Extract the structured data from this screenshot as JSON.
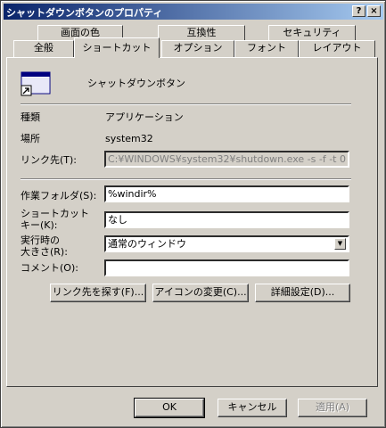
{
  "window": {
    "title": "シャットダウンボタンのプロパティ",
    "help": "?",
    "close": "×"
  },
  "tabs_back": [
    "画面の色",
    "互換性",
    "セキュリティ"
  ],
  "tabs_front": [
    "全般",
    "ショートカット",
    "オプション",
    "フォント",
    "レイアウト"
  ],
  "header": {
    "name": "シャットダウンボタン"
  },
  "info": {
    "type_label": "種類",
    "type_value": "アプリケーション",
    "location_label": "場所",
    "location_value": "system32",
    "target_label": "リンク先(T):",
    "target_value": "C:¥WINDOWS¥system32¥shutdown.exe -s -f -t 0"
  },
  "fields": {
    "workdir_label": "作業フォルダ(S):",
    "workdir_value": "%windir%",
    "shortcut_label_1": "ショートカット",
    "shortcut_label_2": "キー(K):",
    "shortcut_value": "なし",
    "run_label_1": "実行時の",
    "run_label_2": "大きさ(R):",
    "run_value": "通常のウィンドウ",
    "comment_label": "コメント(O):",
    "comment_value": ""
  },
  "buttons": {
    "find_target": "リンク先を探す(F)...",
    "change_icon": "アイコンの変更(C)...",
    "advanced": "詳細設定(D)...",
    "ok": "OK",
    "cancel": "キャンセル",
    "apply": "適用(A)"
  }
}
